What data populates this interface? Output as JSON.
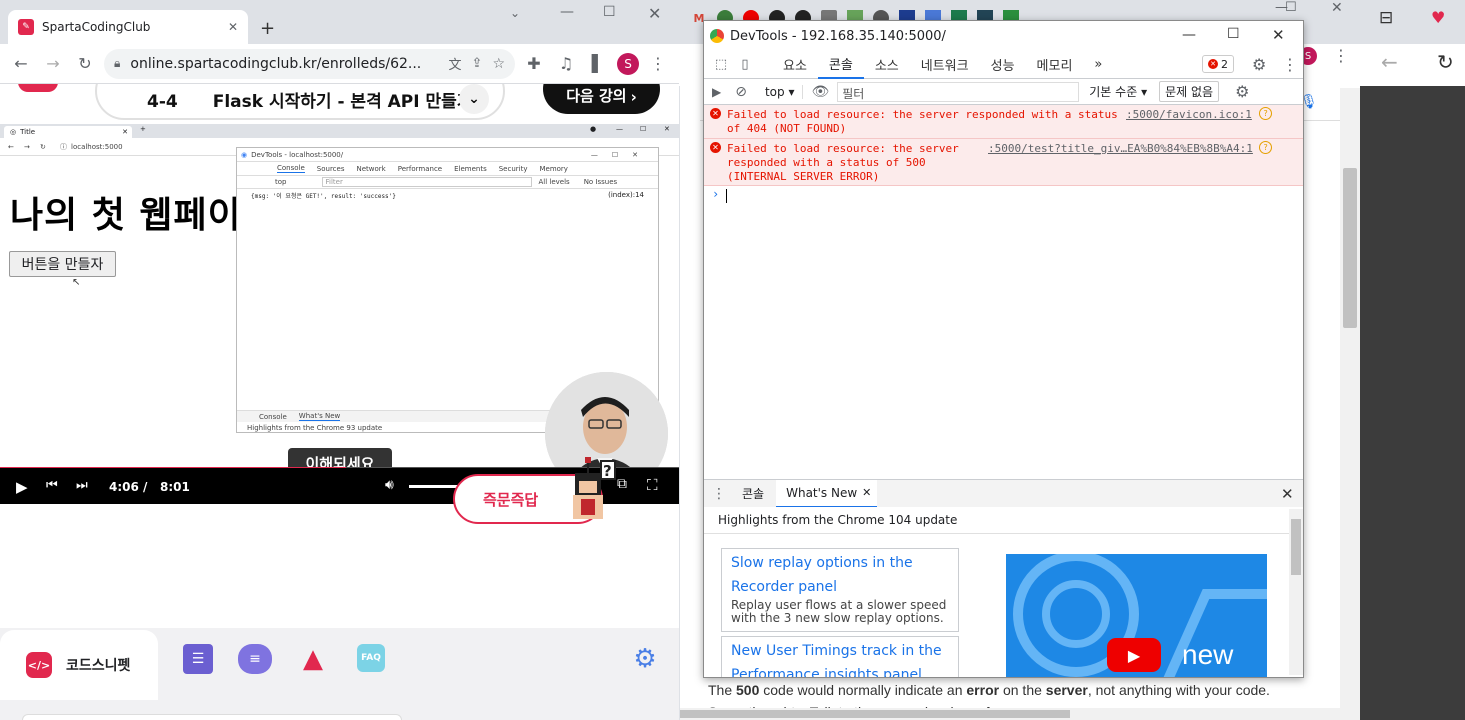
{
  "left_window": {
    "tab_title": "SpartaCodingClub",
    "url": "online.spartacodingclub.kr/enrolleds/62...",
    "lesson": {
      "number": "4-4",
      "title": "Flask 시작하기 - 본격 API 만들기",
      "next_label": "다음 강의"
    },
    "video": {
      "inner_tab_title": "Title",
      "inner_url": "localhost:5000",
      "heading": "나의 첫 웹페이",
      "page_button": "버튼을 만들자",
      "mini_devtools": {
        "title": "DevTools - localhost:5000/",
        "tabs": [
          "Console",
          "Sources",
          "Network",
          "Performance",
          "Elements",
          "Security",
          "Memory"
        ],
        "context": "top",
        "filter_placeholder": "Filter",
        "levels": "All levels",
        "issues": "No Issues",
        "log_line": "{msg: '이 요청은 GET!', result: 'success'}",
        "log_source": "(index):14",
        "drawer_tabs": [
          "Console",
          "What's New"
        ],
        "drawer_text": "Highlights from the Chrome 93 update"
      },
      "tooltip": "이해되세요",
      "current_time": "4:06",
      "separator": "/",
      "duration": "8:01",
      "progress": 0.51
    },
    "quick_answer": "즉문즉답",
    "bottom_tab_active": "코드스니펫",
    "faq_label": "FAQ"
  },
  "devtools": {
    "title": "DevTools - 192.168.35.140:5000/",
    "tabs": [
      "요소",
      "콘솔",
      "소스",
      "네트워크",
      "성능",
      "메모리"
    ],
    "active_tab": "콘솔",
    "more": "»",
    "error_count": "2",
    "context": "top",
    "filter_placeholder": "필터",
    "levels": "기본 수준",
    "issues": "문제 없음",
    "errors": [
      {
        "line1": "Failed to load resource: the server responded with a status",
        "line2": "of 404 (NOT FOUND)",
        "source": ":5000/favicon.ico:1"
      },
      {
        "line1": "Failed to load resource: the server",
        "line2": "responded with a status of 500",
        "line3": "(INTERNAL SERVER ERROR)",
        "source": ":5000/test?title_giv…EA%B0%84%EB%8B%A4:1"
      }
    ],
    "prompt": "›",
    "drawer_tabs": [
      "콘솔",
      "What's New"
    ],
    "whats_new_heading": "Highlights from the Chrome 104 update",
    "cards": [
      {
        "title1": "Slow replay options in the",
        "title2": "Recorder panel",
        "desc1": "Replay user flows at a slower speed",
        "desc2": "with the 3 new slow replay options."
      },
      {
        "title1": "New User Timings track in the",
        "title2": "Performance insights panel"
      }
    ],
    "video_label": "new"
  },
  "right_page": {
    "text_pre": "The ",
    "text_500": "500",
    "text_mid": " code would normally indicate an ",
    "text_error": "error",
    "text_mid2": " on the ",
    "text_server": "server",
    "text_post": ", not anything with your code.",
    "text_next": "Some thoughts. Talk to the server developer for"
  },
  "colors": {
    "accent": "#e1284e",
    "devtools_error": "#e51400",
    "link": "#1a73e8"
  }
}
